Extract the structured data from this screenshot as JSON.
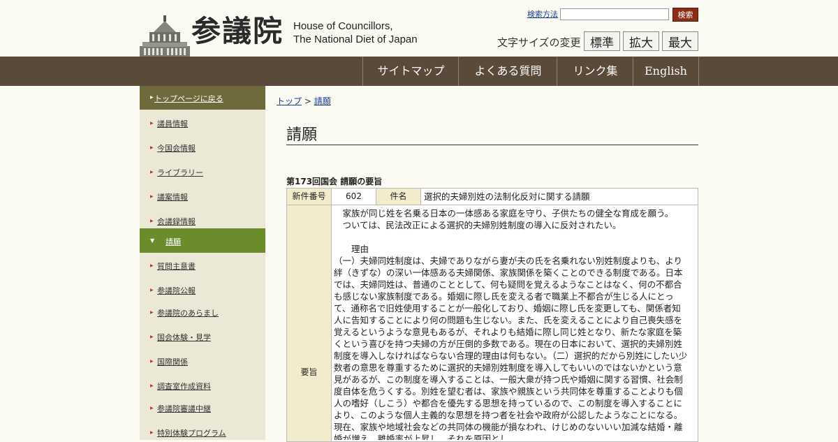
{
  "header": {
    "logo_kanji": "参議院",
    "logo_en_line1": "House of Councillors,",
    "logo_en_line2": "The National Diet of Japan",
    "search_link": "検索方法",
    "search_button": "検索",
    "font_size_label": "文字サイズの変更",
    "font_sizes": [
      "標準",
      "拡大",
      "最大"
    ]
  },
  "nav": [
    "サイトマップ",
    "よくある質問",
    "リンク集",
    "English"
  ],
  "sidebar": {
    "top": "トップページに戻る",
    "items": [
      "議員情報",
      "今国会情報",
      "ライブラリー",
      "議案情報",
      "会議録情報",
      "請願",
      "質問主意書",
      "参議院公報",
      "参議院のあらまし",
      "国会体験・見学",
      "国際関係",
      "調査室作成資料",
      "参議院審議中継",
      "特別体験プログラム"
    ],
    "active": "請願"
  },
  "breadcrumb": {
    "home": "トップ",
    "sep": ">",
    "current": "請願"
  },
  "page_title": "請願",
  "session_heading": "第173回国会 請願の要旨",
  "table": {
    "label_number": "新件番号",
    "number": "602",
    "label_subject": "件名",
    "subject": "選択的夫婦別姓の法制化反対に関する請願",
    "label_summary": "要旨",
    "summary": "　家族が同じ姓を名乗る日本の一体感ある家庭を守り、子供たちの健全な育成を願う。\n　ついては、民法改正による選択的夫婦別姓制度の導入に反対されたい。\n\n　　理由\n（一）夫婦同姓制度は、夫婦でありながら妻が夫の氏を名乗れない別姓制度よりも、より絆（きずな）の深い一体感ある夫婦関係、家族関係を築くことのできる制度である。日本では、夫婦同姓は、普通のこととして、何も疑問を覚えるようなことはなく、何の不都合も感じない家族制度である。婚姻に際し氏を変える者で職業上不都合が生じる人にとって、通称名で旧姓使用することが一般化しており、婚姻に際し氏を変更しても、関係者知人に告知することにより何の問題も生じない。また、氏を変えることにより自己喪失感を覚えるというような意見もあるが、それよりも結婚に際し同じ姓となり、新たな家庭を築くという喜びを持つ夫婦の方が圧倒的多数である。現在の日本において、選択的夫婦別姓制度を導入しなければならない合理的理由は何もない。（二）選択的だから別姓にしたい少数者の意思を尊重するために選択的夫婦別姓制度を導入してもいいのではないかという意見があるが、この制度を導入することは、一般大衆が持つ氏や婚姻に関する習慣、社会制度自体を危うくする。別姓を望む者は、家族や親族という共同体を尊重することよりも個人の嗜好（しこう）や都合を優先する思想を持っているので、この制度を導入することにより、このような個人主義的な思想を持つ者を社会や政府が公認したようなことになる。現在、家族や地域社会などの共同体の機能が損なわれ、けじめのないいい加減な結婚・離婚が増え、離婚率が上昇し、それを原因とし"
  }
}
